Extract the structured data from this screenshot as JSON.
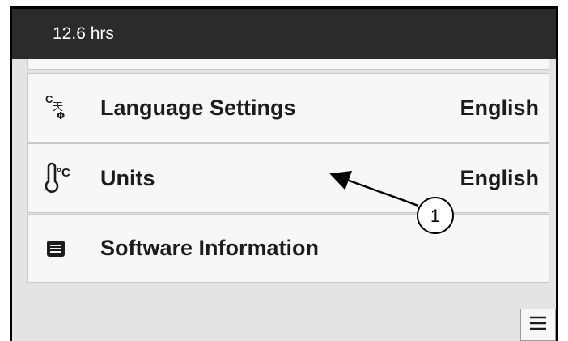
{
  "status_bar": {
    "hours": "12.6 hrs"
  },
  "settings": [
    {
      "id": "language",
      "icon": "language-icon",
      "label": "Language Settings",
      "value": "English"
    },
    {
      "id": "units",
      "icon": "thermometer-celsius-icon",
      "label": "Units",
      "value": "English"
    },
    {
      "id": "software",
      "icon": "document-list-icon",
      "label": "Software Information",
      "value": ""
    }
  ],
  "callout": {
    "number": "1"
  },
  "menu_button": {
    "icon": "hamburger-menu-icon"
  },
  "language_icon": {
    "top_glyph": "C",
    "mid_glyph": "天",
    "bottom_glyph": "Φ"
  },
  "units_icon": {
    "symbol": "°C"
  }
}
